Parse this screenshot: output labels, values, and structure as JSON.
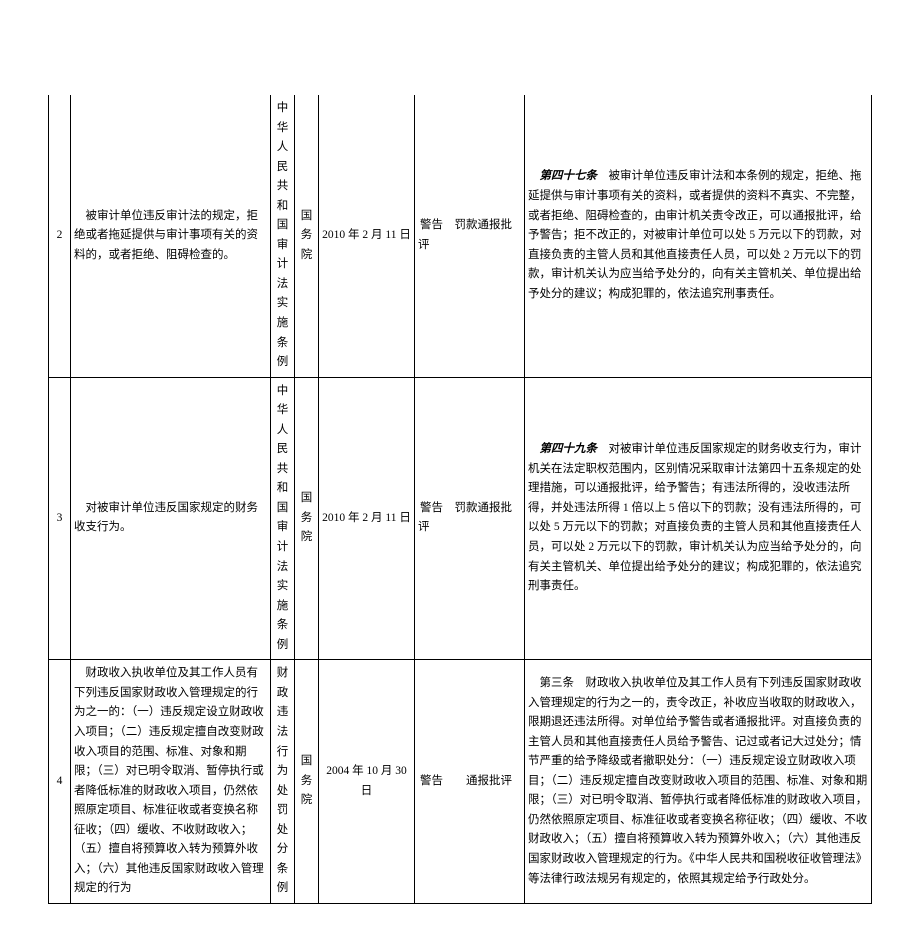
{
  "rows": [
    {
      "num": "2",
      "desc": "被审计单位违反审计法的规定，拒绝或者拖延提供与审计事项有关的资料的，或者拒绝、阻碍检查的。",
      "law": "中华人民共和国审计法实施条例",
      "agency": "国务院",
      "date": "2010 年 2 月 11 日",
      "penalty": "警告　罚款通报批评",
      "detail_lead": "第四十七条",
      "detail_rest": "　被审计单位违反审计法和本条例的规定，拒绝、拖延提供与审计事项有关的资料，或者提供的资料不真实、不完整，或者拒绝、阻碍检查的，由审计机关责令改正，可以通报批评，给予警告；拒不改正的，对被审计单位可以处 5 万元以下的罚款，对直接负责的主管人员和其他直接责任人员，可以处 2 万元以下的罚款，审计机关认为应当给予处分的，向有关主管机关、单位提出给予处分的建议；构成犯罪的，依法追究刑事责任。"
    },
    {
      "num": "3",
      "desc": "对被审计单位违反国家规定的财务收支行为。",
      "law": "中华人民共和国审计法实施条例",
      "agency": "国务院",
      "date": "2010 年 2 月 11 日",
      "penalty": "警告　罚款通报批评",
      "detail_lead": "第四十九条",
      "detail_rest": "　对被审计单位违反国家规定的财务收支行为，审计机关在法定职权范围内，区别情况采取审计法第四十五条规定的处理措施，可以通报批评，给予警告；有违法所得的，没收违法所得，并处违法所得 1 倍以上 5 倍以下的罚款；没有违法所得的，可以处 5 万元以下的罚款；对直接负责的主管人员和其他直接责任人员，可以处 2 万元以下的罚款，审计机关认为应当给予处分的，向有关主管机关、单位提出给予处分的建议；构成犯罪的，依法追究刑事责任。"
    },
    {
      "num": "4",
      "desc": "财政收入执收单位及其工作人员有下列违反国家财政收入管理规定的行为之一的：（一）违反规定设立财政收入项目；（二）违反规定擅自改变财政收入项目的范围、标准、对象和期限；（三）对已明令取消、暂停执行或者降低标准的财政收入项目，仍然依照原定项目、标准征收或者变换名称征收；（四）缓收、不收财政收入；（五）擅自将预算收入转为预算外收入；（六）其他违反国家财政收入管理规定的行为",
      "law": "财政违法行为处罚处分条例",
      "agency": "国务院",
      "date": "2004 年 10 月 30 日",
      "penalty": "警告　　通报批评",
      "detail_lead": "",
      "detail_rest": "第三条　财政收入执收单位及其工作人员有下列违反国家财政收入管理规定的行为之一的，责令改正，补收应当收取的财政收入，限期退还违法所得。对单位给予警告或者通报批评。对直接负责的主管人员和其他直接责任人员给予警告、记过或者记大过处分；情节严重的给予降级或者撤职处分：（一）违反规定设立财政收入项目；（二）违反规定擅自改变财政收入项目的范围、标准、对象和期限；（三）对已明令取消、暂停执行或者降低标准的财政收入项目，仍然依照原定项目、标准征收或者变换名称征收；（四）缓收、不收财政收入；（五）擅自将预算收入转为预算外收入；（六）其他违反国家财政收入管理规定的行为。《中华人民共和国税收征收管理法》等法律行政法规另有规定的，依照其规定给予行政处分。"
    }
  ]
}
